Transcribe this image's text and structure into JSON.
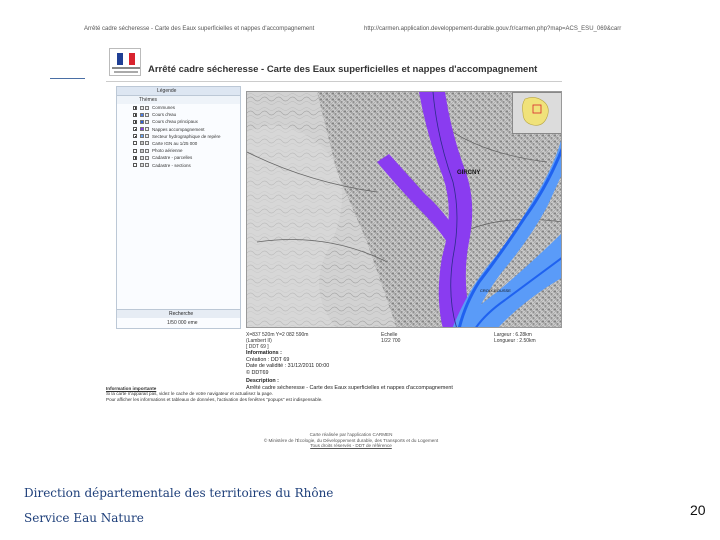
{
  "browser": {
    "title_text": "Arrêté cadre sécheresse - Carte des Eaux superficielles et nappes d'accompagnement",
    "url_text": "http://carmen.application.developpement-durable.gouv.fr/carmen.php?map=ACS_ESU_069&carr"
  },
  "app": {
    "title": "Arrêté cadre sécheresse - Carte des Eaux superficielles et nappes d'accompagnement",
    "colors": {
      "river_zone": "#8a3cf0",
      "river_main": "#1f62f0",
      "river_band": "#5a9bf8"
    }
  },
  "sidebar": {
    "header": "Légende",
    "subheader": "Thèmes",
    "layers": [
      {
        "label": "Communes",
        "checked": true,
        "swatch": "#e8e8e8"
      },
      {
        "label": "Cours d'eau",
        "checked": true,
        "swatch": "#4a7ff0"
      },
      {
        "label": "Cours d'eau principaux",
        "checked": true,
        "swatch": "#2c5fd8"
      },
      {
        "label": "Nappes accompagnement",
        "checked": true,
        "swatch": "#8a3cf0"
      },
      {
        "label": "Secteur hydrographique de repère",
        "checked": true,
        "swatch": "#6aa6f8"
      },
      {
        "label": "Carte IGN au 1/25 000",
        "checked": false,
        "swatch": "#c8c8c8"
      },
      {
        "label": "Photo aérienne",
        "checked": false,
        "swatch": "#c8c8c8"
      },
      {
        "label": "Cadastre - parcelles",
        "checked": true,
        "swatch": "#ddd"
      },
      {
        "label": "Cadastre - sections",
        "checked": false,
        "swatch": "#ddd"
      }
    ],
    "search_label": "Recherche",
    "scale_label": "1/50 000 eme"
  },
  "map": {
    "labels": [
      "GIRCNY",
      "CROIX-ROUSSE"
    ],
    "status_coords": "X=837 520m Y=2 082 590m\n(Lambert II)\n[ DDT 69 ]",
    "status_scale": "Echelle\n1/22 700",
    "status_width": "Largeur : 6.28km\nLongueur : 2.50km"
  },
  "info": {
    "title": "Informations :",
    "lines": [
      "Création : DDT 69",
      "Date de validité : 31/12/2011 00:00",
      "© DDT69"
    ],
    "desc_title": "Description :",
    "desc_text": "Arrêté cadre sécheresse - Carte des Eaux superficielles et nappes d'accompagnement"
  },
  "notice": {
    "title": "Information importante",
    "line1": "Si la carte n'apparait pas, videz le cache de votre navigateur et actualisez la page.",
    "line2": "Pour afficher les informations et tableaux de données, l'activation des fenêtres \"popups\" est indispensable."
  },
  "credit": {
    "line1": "Carte réalisée par l'application CARMEN",
    "line2": "© Ministère de l'Écologie, du Développement durable, des Transports et du Logement",
    "line3": "Tous droits réservés - DDT de référence"
  },
  "slide": {
    "footer_line1": "Direction départementale des territoires du Rhône",
    "footer_line2": "Service Eau Nature",
    "page_number": "20"
  }
}
